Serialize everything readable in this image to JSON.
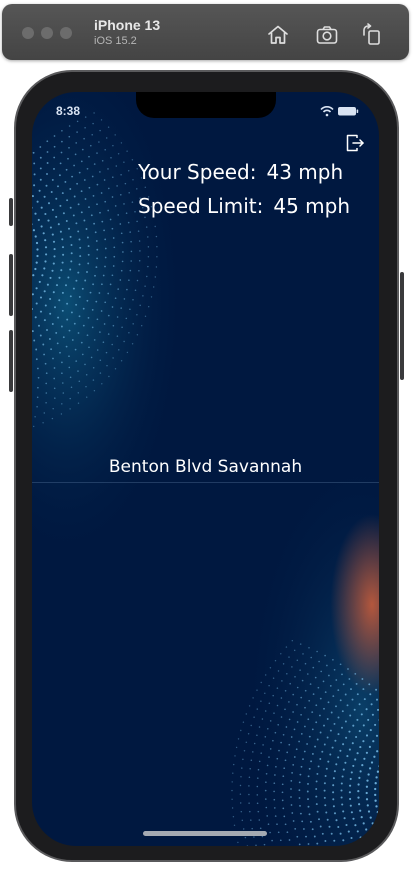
{
  "simulator": {
    "device_name": "iPhone 13",
    "os_version": "iOS 15.2",
    "toolbar_buttons": [
      {
        "name": "home",
        "icon": "home-icon"
      },
      {
        "name": "screenshot",
        "icon": "camera-icon"
      },
      {
        "name": "rotate",
        "icon": "rotate-icon"
      }
    ]
  },
  "status_bar": {
    "time": "8:38",
    "icons": [
      "wifi-icon",
      "battery-icon"
    ]
  },
  "speed_panel": {
    "your_speed_label": "Your Speed:",
    "your_speed_value": "43 mph",
    "speed_limit_label": "Speed Limit:",
    "speed_limit_value": "45 mph"
  },
  "location": {
    "street": "Benton Blvd Savannah"
  },
  "header_actions": {
    "logout_icon": "logout-icon"
  },
  "colors": {
    "screen_background": "#001840",
    "dot_pattern": "#7ec3ee",
    "accent_orange": "#d2603a",
    "text": "#ffffff"
  }
}
